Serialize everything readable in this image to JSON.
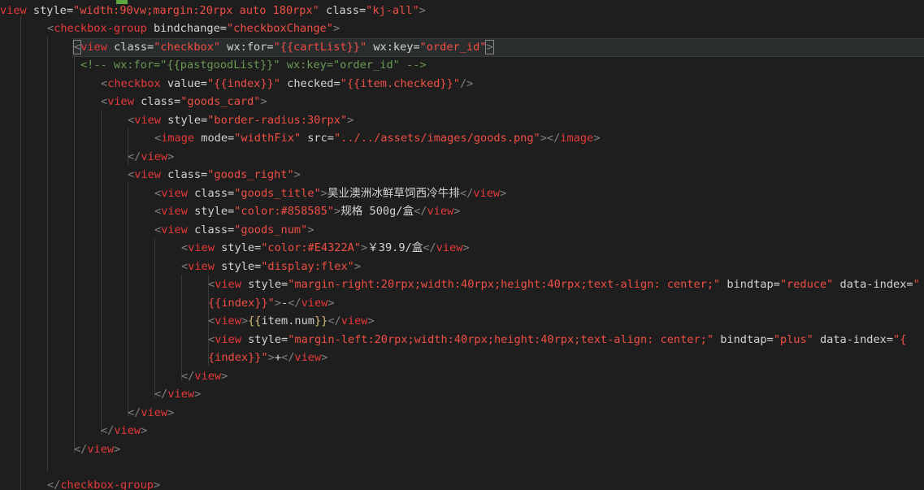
{
  "editor": {
    "lines": [
      [
        {
          "t": "view",
          "c": "t-tag"
        },
        {
          "t": " style=",
          "c": "t-attr"
        },
        {
          "t": "\"width:90vw;margin:20rpx auto 180rpx\"",
          "c": "t-str-red"
        },
        {
          "t": " class=",
          "c": "t-attr"
        },
        {
          "t": "\"kj-all\"",
          "c": "t-str-red"
        },
        {
          "t": ">",
          "c": "t-punct"
        }
      ],
      [
        {
          "t": "<",
          "c": "t-punct"
        },
        {
          "t": "checkbox-group",
          "c": "t-tag"
        },
        {
          "t": " bindchange=",
          "c": "t-attr"
        },
        {
          "t": "\"checkboxChange\"",
          "c": "t-str-red"
        },
        {
          "t": ">",
          "c": "t-punct"
        }
      ],
      [
        {
          "t": "<",
          "c": "t-punct bracket-box"
        },
        {
          "t": "view",
          "c": "t-tag"
        },
        {
          "t": " class=",
          "c": "t-attr"
        },
        {
          "t": "\"checkbox\"",
          "c": "t-str-red"
        },
        {
          "t": " wx:for=",
          "c": "t-attr"
        },
        {
          "t": "\"{{cartList}}\"",
          "c": "t-str-red"
        },
        {
          "t": " wx:key=",
          "c": "t-attr"
        },
        {
          "t": "\"order_id\"",
          "c": "t-str-red"
        },
        {
          "t": ">",
          "c": "t-punct bracket-box"
        }
      ],
      [
        {
          "t": "<!-- wx:for=\"{{pastgoodList}}\" wx:key=\"order_id\" -->",
          "c": "t-comment"
        }
      ],
      [
        {
          "t": "<",
          "c": "t-punct"
        },
        {
          "t": "checkbox",
          "c": "t-tag"
        },
        {
          "t": " value=",
          "c": "t-attr"
        },
        {
          "t": "\"{{index}}\"",
          "c": "t-str-red"
        },
        {
          "t": " checked=",
          "c": "t-attr"
        },
        {
          "t": "\"{{item.checked}}\"",
          "c": "t-str-red"
        },
        {
          "t": "/>",
          "c": "t-punct"
        }
      ],
      [
        {
          "t": "<",
          "c": "t-punct"
        },
        {
          "t": "view",
          "c": "t-tag"
        },
        {
          "t": " class=",
          "c": "t-attr"
        },
        {
          "t": "\"goods_card\"",
          "c": "t-str-red"
        },
        {
          "t": ">",
          "c": "t-punct"
        }
      ],
      [
        {
          "t": "<",
          "c": "t-punct"
        },
        {
          "t": "view",
          "c": "t-tag"
        },
        {
          "t": " style=",
          "c": "t-attr"
        },
        {
          "t": "\"border-radius:30rpx\"",
          "c": "t-str-red"
        },
        {
          "t": ">",
          "c": "t-punct"
        }
      ],
      [
        {
          "t": "<",
          "c": "t-punct"
        },
        {
          "t": "image",
          "c": "t-tag"
        },
        {
          "t": " mode=",
          "c": "t-attr"
        },
        {
          "t": "\"widthFix\"",
          "c": "t-str-red"
        },
        {
          "t": " src=",
          "c": "t-attr"
        },
        {
          "t": "\"../../assets/images/goods.png\"",
          "c": "t-str-red"
        },
        {
          "t": "></",
          "c": "t-punct"
        },
        {
          "t": "image",
          "c": "t-tag"
        },
        {
          "t": ">",
          "c": "t-punct"
        }
      ],
      [
        {
          "t": "</",
          "c": "t-punct"
        },
        {
          "t": "view",
          "c": "t-tag"
        },
        {
          "t": ">",
          "c": "t-punct"
        }
      ],
      [
        {
          "t": "<",
          "c": "t-punct"
        },
        {
          "t": "view",
          "c": "t-tag"
        },
        {
          "t": " class=",
          "c": "t-attr"
        },
        {
          "t": "\"goods_right\"",
          "c": "t-str-red"
        },
        {
          "t": ">",
          "c": "t-punct"
        }
      ],
      [
        {
          "t": "<",
          "c": "t-punct"
        },
        {
          "t": "view",
          "c": "t-tag"
        },
        {
          "t": " class=",
          "c": "t-attr"
        },
        {
          "t": "\"goods_title\"",
          "c": "t-str-red"
        },
        {
          "t": ">",
          "c": "t-punct"
        },
        {
          "t": "昊业澳洲冰鲜草饲西冷牛排",
          "c": "t-text"
        },
        {
          "t": "</",
          "c": "t-punct"
        },
        {
          "t": "view",
          "c": "t-tag"
        },
        {
          "t": ">",
          "c": "t-punct"
        }
      ],
      [
        {
          "t": "<",
          "c": "t-punct"
        },
        {
          "t": "view",
          "c": "t-tag"
        },
        {
          "t": " style=",
          "c": "t-attr"
        },
        {
          "t": "\"color:#858585\"",
          "c": "t-str-red"
        },
        {
          "t": ">",
          "c": "t-punct"
        },
        {
          "t": "规格 500g/盒",
          "c": "t-text"
        },
        {
          "t": "</",
          "c": "t-punct"
        },
        {
          "t": "view",
          "c": "t-tag"
        },
        {
          "t": ">",
          "c": "t-punct"
        }
      ],
      [
        {
          "t": "<",
          "c": "t-punct"
        },
        {
          "t": "view",
          "c": "t-tag"
        },
        {
          "t": " class=",
          "c": "t-attr"
        },
        {
          "t": "\"goods_num\"",
          "c": "t-str-red"
        },
        {
          "t": ">",
          "c": "t-punct"
        }
      ],
      [
        {
          "t": "<",
          "c": "t-punct"
        },
        {
          "t": "view",
          "c": "t-tag"
        },
        {
          "t": " style=",
          "c": "t-attr"
        },
        {
          "t": "\"color:#E4322A\"",
          "c": "t-str-red"
        },
        {
          "t": ">",
          "c": "t-punct"
        },
        {
          "t": "￥39.9/盒",
          "c": "t-text"
        },
        {
          "t": "</",
          "c": "t-punct"
        },
        {
          "t": "view",
          "c": "t-tag"
        },
        {
          "t": ">",
          "c": "t-punct"
        }
      ],
      [
        {
          "t": "<",
          "c": "t-punct"
        },
        {
          "t": "view",
          "c": "t-tag"
        },
        {
          "t": " style=",
          "c": "t-attr"
        },
        {
          "t": "\"display:flex\"",
          "c": "t-str-red"
        },
        {
          "t": ">",
          "c": "t-punct"
        }
      ],
      [
        {
          "t": "<",
          "c": "t-punct"
        },
        {
          "t": "view",
          "c": "t-tag"
        },
        {
          "t": " style=",
          "c": "t-attr"
        },
        {
          "t": "\"margin-right:20rpx;width:40rpx;height:40rpx;text-align: center;\"",
          "c": "t-str-red"
        },
        {
          "t": " bindtap=",
          "c": "t-attr"
        },
        {
          "t": "\"reduce\"",
          "c": "t-str-red"
        },
        {
          "t": " data-index=",
          "c": "t-attr"
        },
        {
          "t": "\"",
          "c": "t-str-red"
        }
      ],
      [
        {
          "t": "{{index}}\"",
          "c": "t-str-red"
        },
        {
          "t": ">",
          "c": "t-punct"
        },
        {
          "t": "-",
          "c": "t-text"
        },
        {
          "t": "</",
          "c": "t-punct"
        },
        {
          "t": "view",
          "c": "t-tag"
        },
        {
          "t": ">",
          "c": "t-punct"
        }
      ],
      [
        {
          "t": "<",
          "c": "t-punct"
        },
        {
          "t": "view",
          "c": "t-tag"
        },
        {
          "t": ">",
          "c": "t-punct"
        },
        {
          "t": "{{",
          "c": "t-brace"
        },
        {
          "t": "item.num",
          "c": "t-text"
        },
        {
          "t": "}}",
          "c": "t-brace"
        },
        {
          "t": "</",
          "c": "t-punct"
        },
        {
          "t": "view",
          "c": "t-tag"
        },
        {
          "t": ">",
          "c": "t-punct"
        }
      ],
      [
        {
          "t": "<",
          "c": "t-punct"
        },
        {
          "t": "view",
          "c": "t-tag"
        },
        {
          "t": " style=",
          "c": "t-attr"
        },
        {
          "t": "\"margin-left:20rpx;width:40rpx;height:40rpx;text-align: center;\"",
          "c": "t-str-red"
        },
        {
          "t": " bindtap=",
          "c": "t-attr"
        },
        {
          "t": "\"plus\"",
          "c": "t-str-red"
        },
        {
          "t": " data-index=",
          "c": "t-attr"
        },
        {
          "t": "\"{",
          "c": "t-str-red"
        }
      ],
      [
        {
          "t": "{index}}\"",
          "c": "t-str-red"
        },
        {
          "t": ">",
          "c": "t-punct"
        },
        {
          "t": "+",
          "c": "t-text"
        },
        {
          "t": "</",
          "c": "t-punct"
        },
        {
          "t": "view",
          "c": "t-tag"
        },
        {
          "t": ">",
          "c": "t-punct"
        }
      ],
      [
        {
          "t": "</",
          "c": "t-punct"
        },
        {
          "t": "view",
          "c": "t-tag"
        },
        {
          "t": ">",
          "c": "t-punct"
        }
      ],
      [
        {
          "t": "</",
          "c": "t-punct"
        },
        {
          "t": "view",
          "c": "t-tag"
        },
        {
          "t": ">",
          "c": "t-punct"
        }
      ],
      [
        {
          "t": "</",
          "c": "t-punct"
        },
        {
          "t": "view",
          "c": "t-tag"
        },
        {
          "t": ">",
          "c": "t-punct"
        }
      ],
      [
        {
          "t": "</",
          "c": "t-punct"
        },
        {
          "t": "view",
          "c": "t-tag"
        },
        {
          "t": ">",
          "c": "t-punct"
        }
      ],
      [
        {
          "t": "</",
          "c": "t-punct"
        },
        {
          "t": "view",
          "c": "t-tag"
        },
        {
          "t": ">",
          "c": "t-punct"
        }
      ],
      [],
      [
        {
          "t": "</",
          "c": "t-punct"
        },
        {
          "t": "checkbox-group",
          "c": "t-tag"
        },
        {
          "t": ">",
          "c": "t-punct"
        }
      ]
    ],
    "colors": {
      "background": "#1e1e1e",
      "tag": "#e6393a",
      "string": "#ef4f45",
      "comment": "#6a9955",
      "text": "#d4d4d4",
      "punctuation": "#808080"
    }
  }
}
